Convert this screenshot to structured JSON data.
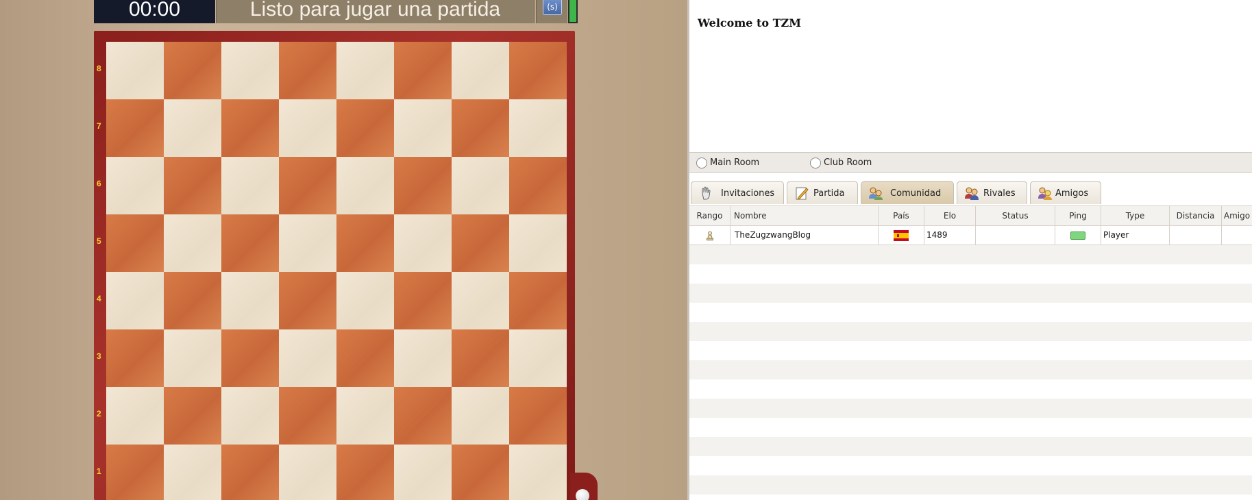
{
  "game": {
    "clock": "00:00",
    "status_text": "Listo para jugar una partida",
    "icon_label": "(s)"
  },
  "board": {
    "ranks": [
      "8",
      "7",
      "6",
      "5",
      "4",
      "3",
      "2",
      "1"
    ]
  },
  "chat": {
    "welcome": "Welcome to TZM"
  },
  "rooms": {
    "main": "Main Room",
    "club": "Club Room"
  },
  "tabs": [
    {
      "label": "Invitaciones",
      "icon": "hand-icon"
    },
    {
      "label": "Partida",
      "icon": "edit-icon"
    },
    {
      "label": "Comunidad",
      "icon": "community-icon"
    },
    {
      "label": "Rivales",
      "icon": "rivals-icon"
    },
    {
      "label": "Amigos",
      "icon": "friends-icon"
    }
  ],
  "table": {
    "columns": [
      "Rango",
      "Nombre",
      "País",
      "Elo",
      "Status",
      "Ping",
      "Type",
      "Distancia",
      "Amigo"
    ],
    "rows": [
      {
        "rango": "pawn-icon",
        "nombre": "TheZugzwangBlog",
        "pais": "spain-flag",
        "elo": "1489",
        "status": "",
        "ping": "good",
        "type": "Player",
        "distancia": "",
        "amigo": ""
      }
    ]
  },
  "colors": {
    "ping_good": "#7fd67f",
    "rank_label": "#f4d23b",
    "status_green": "#3fb54a"
  }
}
